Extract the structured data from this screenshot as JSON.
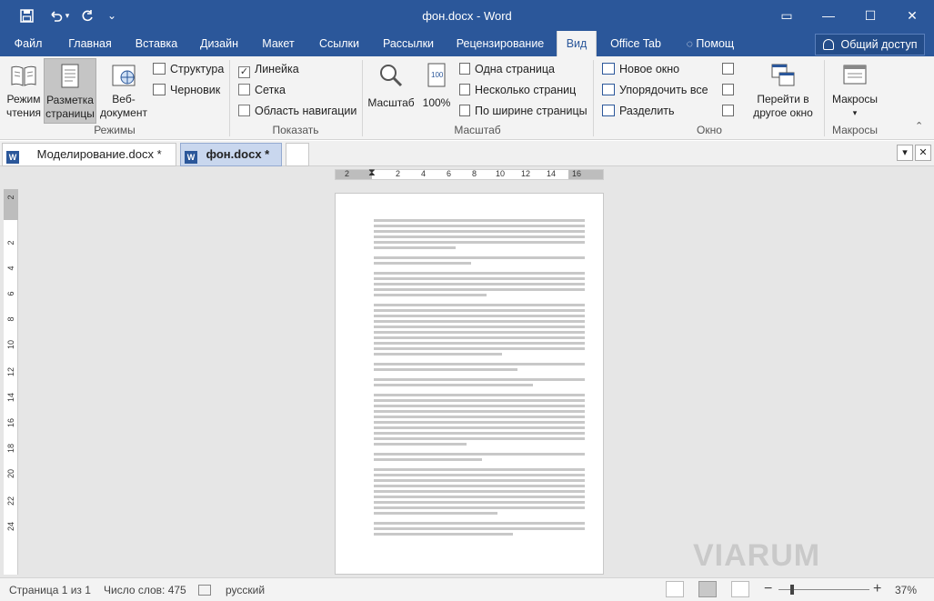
{
  "window": {
    "title": "фон.docx - Word",
    "controls": {
      "ribbon_display": "▭",
      "minimize": "—",
      "maximize": "☐",
      "close": "✕"
    }
  },
  "quick_access": {
    "save_icon": "save-icon",
    "undo_icon": "undo-icon",
    "redo_icon": "redo-icon",
    "customize": "⌄"
  },
  "tabs": [
    {
      "label": "Файл"
    },
    {
      "label": "Главная"
    },
    {
      "label": "Вставка"
    },
    {
      "label": "Дизайн"
    },
    {
      "label": "Макет"
    },
    {
      "label": "Ссылки"
    },
    {
      "label": "Рассылки"
    },
    {
      "label": "Рецензирование"
    },
    {
      "label": "Вид",
      "active": true
    },
    {
      "label": "Office Tab"
    }
  ],
  "tell_me": "Помощ",
  "share_button": "Общий доступ",
  "ribbon": {
    "modes": {
      "group_label": "Режимы",
      "read_mode": [
        "Режим",
        "чтения"
      ],
      "print_layout": [
        "Разметка",
        "страницы"
      ],
      "web_layout": [
        "Веб-",
        "документ"
      ],
      "outline": "Структура",
      "draft": "Черновик"
    },
    "show": {
      "group_label": "Показать",
      "ruler": "Линейка",
      "ruler_checked": true,
      "gridlines": "Сетка",
      "nav_pane": "Область навигации"
    },
    "zoom": {
      "group_label": "Масштаб",
      "zoom": "Масштаб",
      "hundred": "100%",
      "one_page": "Одна страница",
      "multiple_pages": "Несколько страниц",
      "page_width": "По ширине страницы"
    },
    "window": {
      "group_label": "Окно",
      "new_window": "Новое окно",
      "arrange_all": "Упорядочить все",
      "split": "Разделить",
      "switch_windows": [
        "Перейти в",
        "другое окно"
      ]
    },
    "macros": {
      "group_label": "Макросы",
      "macros": "Макросы"
    }
  },
  "doc_tabs": [
    {
      "label": "Моделирование.docx *"
    },
    {
      "label": "фон.docx *",
      "active": true
    }
  ],
  "doc_tab_controls": {
    "dropdown": "▾",
    "close": "✕"
  },
  "rulers": {
    "horizontal": [
      "2",
      "2",
      "4",
      "6",
      "8",
      "10",
      "12",
      "14",
      "16"
    ],
    "vertical": [
      "2",
      "2",
      "4",
      "6",
      "8",
      "10",
      "12",
      "14",
      "16",
      "18",
      "20",
      "22",
      "24"
    ]
  },
  "status": {
    "page": "Страница 1 из 1",
    "words": "Число слов: 475",
    "language": "русский",
    "zoom_minus": "−",
    "zoom_plus": "+",
    "zoom_percent": "37%",
    "zoom_level": 0.37
  },
  "watermark": "VIARUM",
  "colors": {
    "brand": "#2b579a",
    "ribbon_bg": "#f3f3f3",
    "workspace": "#e6e6e6"
  }
}
